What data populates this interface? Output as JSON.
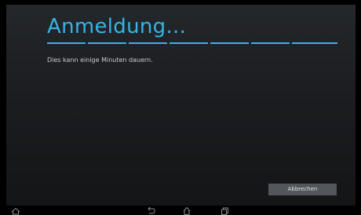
{
  "dialog": {
    "title": "Anmeldung...",
    "message": "Dies kann einige Minuten dauern.",
    "cancel_label": "Abbrechen"
  },
  "navbar": {
    "icons": [
      "menu-icon",
      "back-icon",
      "home-icon",
      "recent-apps-icon"
    ]
  },
  "colors": {
    "accent": "#33b5e5",
    "background": "#1e2023",
    "button": "#53575b"
  }
}
